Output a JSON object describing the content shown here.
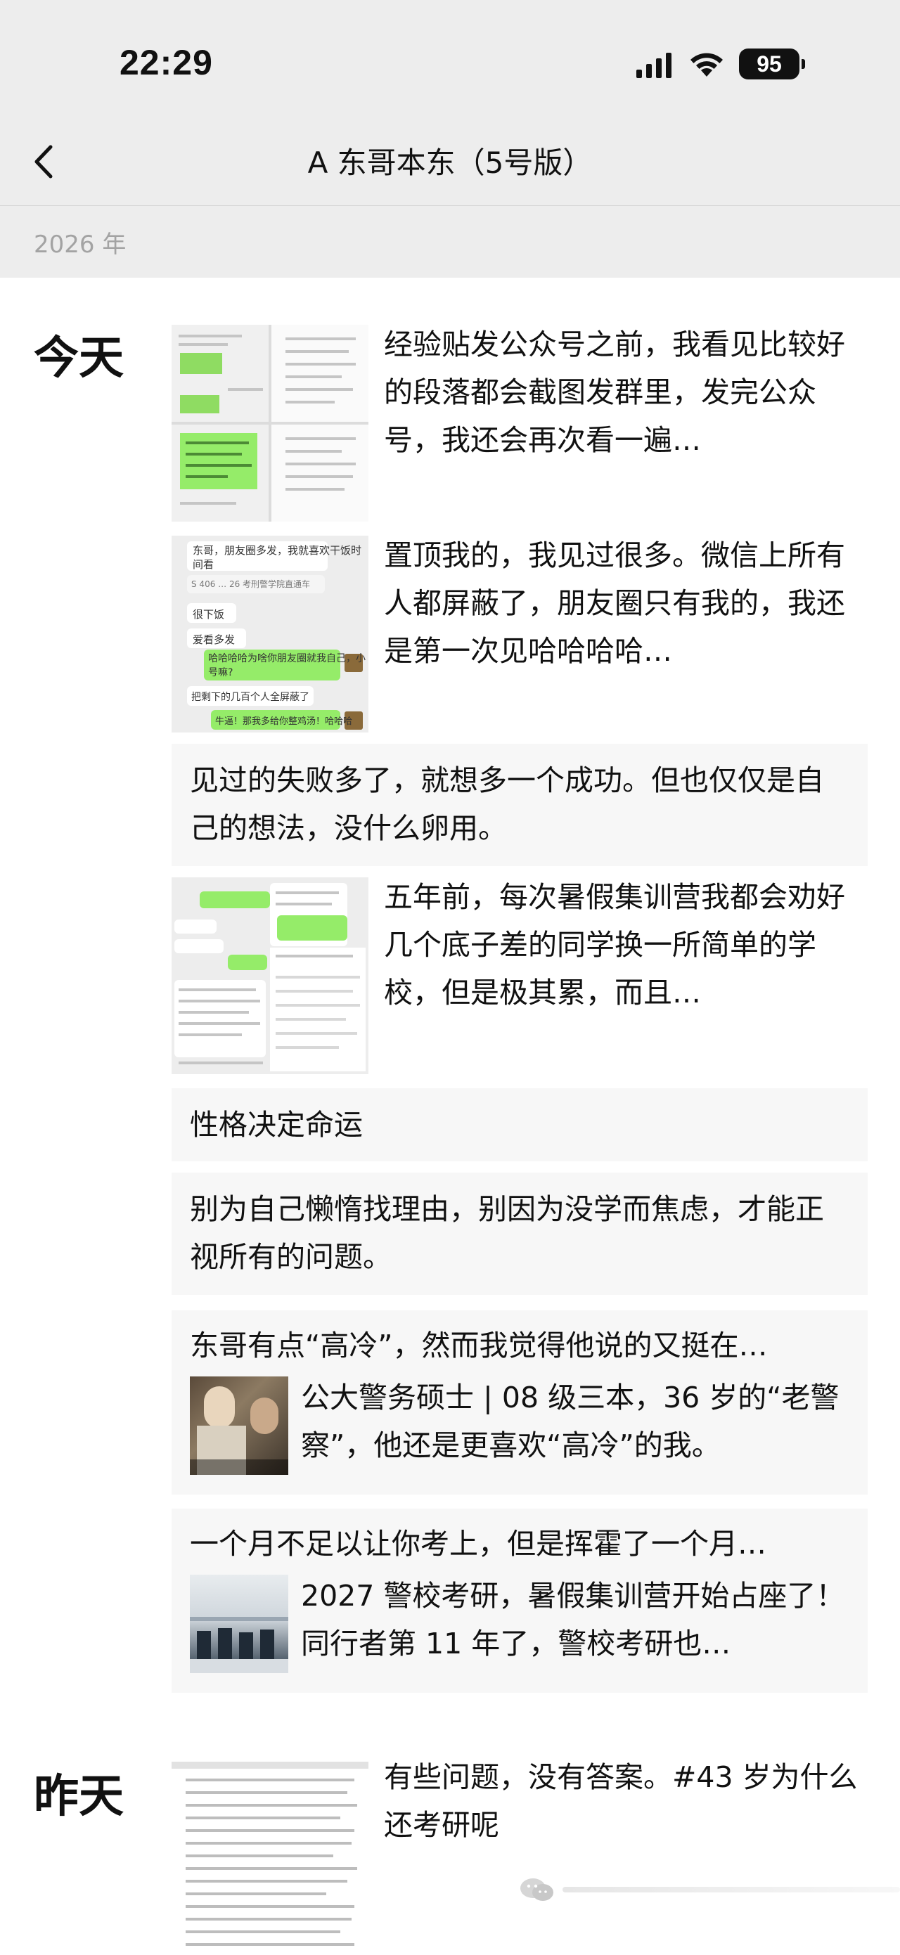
{
  "status_bar": {
    "time": "22:29",
    "battery": "95"
  },
  "header": {
    "title": "A 东哥本东（5号版）",
    "year": "2026 年"
  },
  "days": {
    "today": "今天",
    "yesterday": "昨天"
  },
  "posts": [
    {
      "text": "经验贴发公众号之前，我看见比较好的段落都会截图发群里，发完公众号，我还会再次看一遍…"
    },
    {
      "text": "置顶我的，我见过很多。微信上所有人都屏蔽了，朋友圈只有我的，我还是第一次见哈哈哈哈…",
      "chat": {
        "q1": "东哥，朋友圈多发，我就喜欢干饭时",
        "q2": "间看",
        "q3": "S 406 … 26 考刑警学院直通车",
        "r1": "很下饭",
        "r2": "爱看多发",
        "g1": "哈哈哈哈为啥你朋友圈就我自己，小",
        "g2": "号嘛?",
        "r3": "把剩下的几百个人全屏蔽了",
        "g3": "牛逼！那我多给你整鸡汤！哈哈哈"
      }
    },
    {
      "text": "见过的失败多了，就想多一个成功。但也仅仅是自己的想法，没什么卵用。"
    },
    {
      "text": "五年前，每次暑假集训营我都会劝好几个底子差的同学换一所简单的学校，但是极其累，而且…"
    },
    {
      "text": "性格决定命运"
    },
    {
      "text": "别为自己懒惰找理由，别因为没学而焦虑，才能正视所有的问题。"
    },
    {
      "title": "东哥有点“高冷”，然而我觉得他说的又挺在…",
      "desc": "公大警务硕士 | 08 级三本，36 岁的“老警察”，他还是更喜欢“高冷”的我。"
    },
    {
      "title": "一个月不足以让你考上，但是挥霍了一个月…",
      "desc": "2027 警校考研，暑假集训营开始占座了！同行者第 11 年了，警校考研也…"
    },
    {
      "text": "有些问题，没有答案。#43 岁为什么还考研呢"
    }
  ],
  "icons": [
    "back-icon",
    "signal-icon",
    "wifi-icon",
    "battery-icon",
    "wechat-watermark-icon"
  ]
}
